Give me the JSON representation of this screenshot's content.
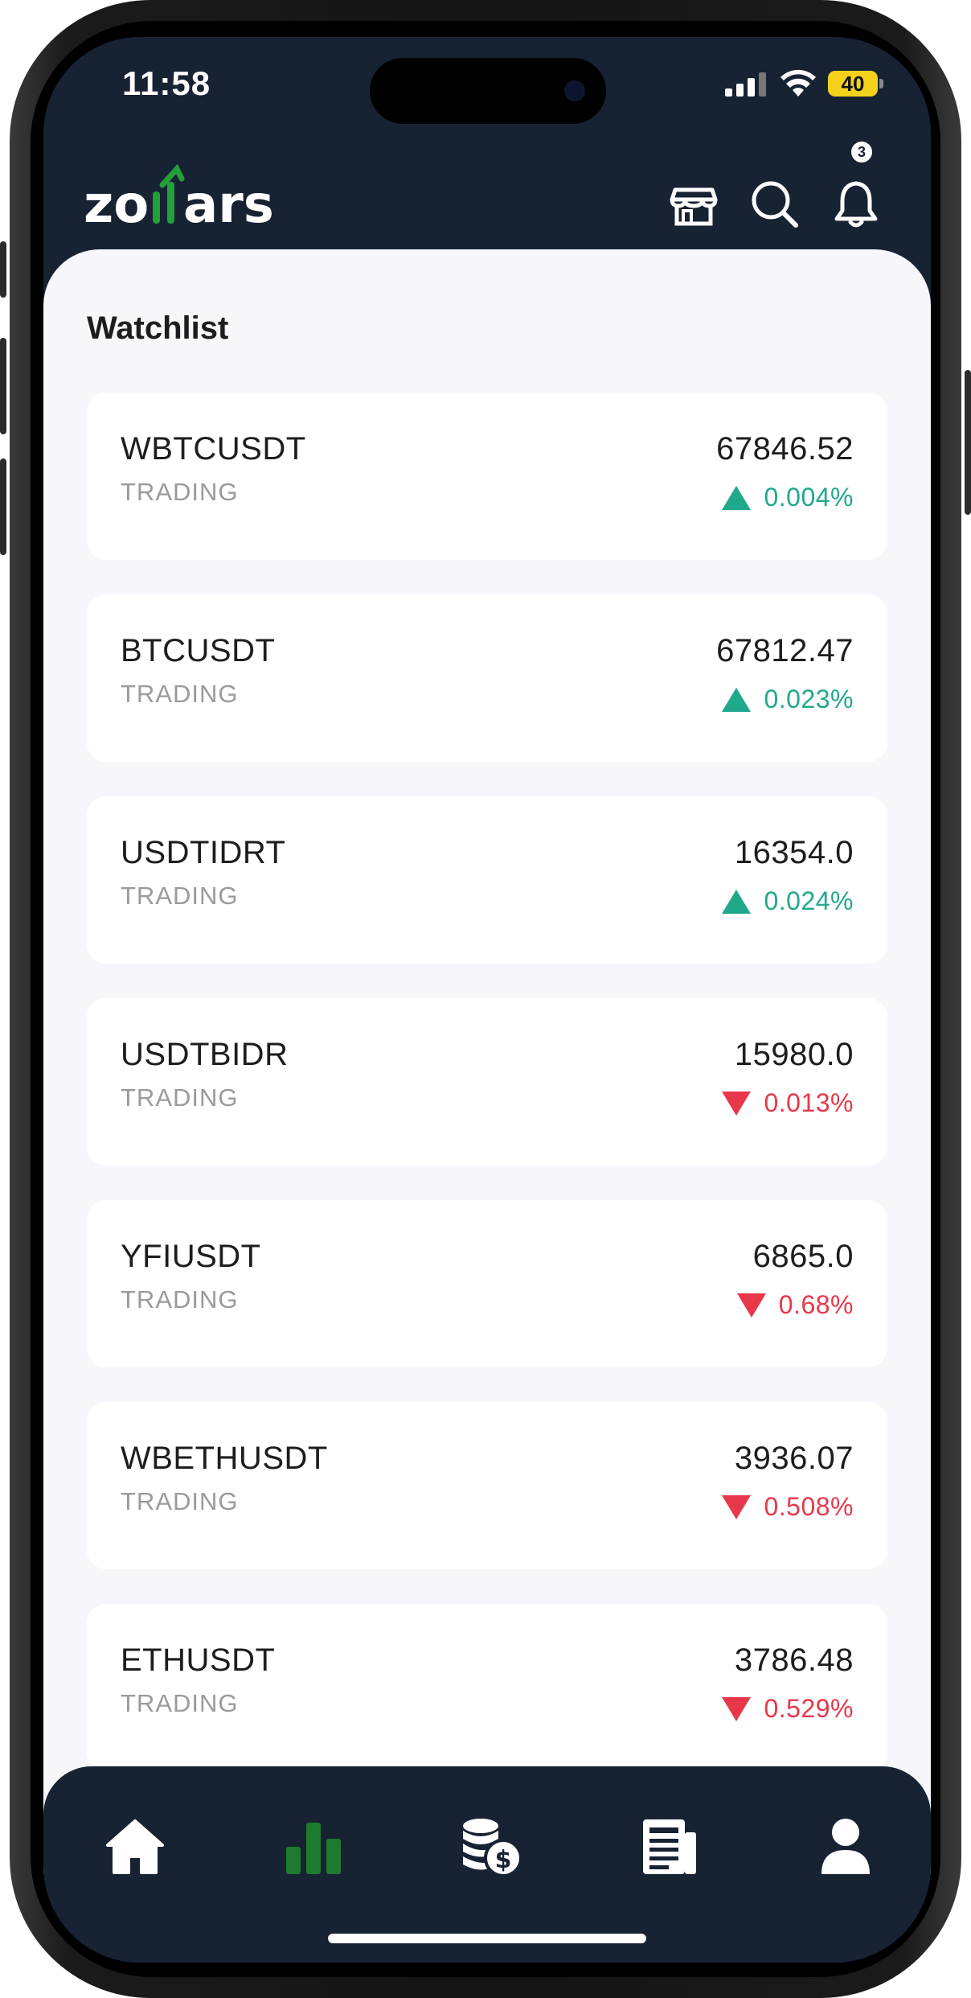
{
  "status_bar": {
    "time": "11:58",
    "battery": "40"
  },
  "header": {
    "logo": "zollars",
    "notification_count": "3",
    "icons": [
      "store-icon",
      "search-icon",
      "bell-icon"
    ]
  },
  "watchlist": {
    "title": "Watchlist",
    "items": [
      {
        "symbol": "WBTCUSDT",
        "status": "TRADING",
        "price": "67846.52",
        "change": "0.004%",
        "direction": "up"
      },
      {
        "symbol": "BTCUSDT",
        "status": "TRADING",
        "price": "67812.47",
        "change": "0.023%",
        "direction": "up"
      },
      {
        "symbol": "USDTIDRT",
        "status": "TRADING",
        "price": "16354.0",
        "change": "0.024%",
        "direction": "up"
      },
      {
        "symbol": "USDTBIDR",
        "status": "TRADING",
        "price": "15980.0",
        "change": "0.013%",
        "direction": "down"
      },
      {
        "symbol": "YFIUSDT",
        "status": "TRADING",
        "price": "6865.0",
        "change": "0.68%",
        "direction": "down"
      },
      {
        "symbol": "WBETHUSDT",
        "status": "TRADING",
        "price": "3936.07",
        "change": "0.508%",
        "direction": "down"
      },
      {
        "symbol": "ETHUSDT",
        "status": "TRADING",
        "price": "3786.48",
        "change": "0.529%",
        "direction": "down"
      }
    ]
  },
  "tab_bar": {
    "tabs": [
      "home-icon",
      "market-chart-icon",
      "coins-dollar-icon",
      "news-icon",
      "profile-icon"
    ],
    "active": "market-chart-icon"
  },
  "colors": {
    "navy": "#172233",
    "up": "#1fa98a",
    "down": "#e8374a",
    "active_tab": "#1e7a2e",
    "logo_accent": "#23a03a"
  }
}
